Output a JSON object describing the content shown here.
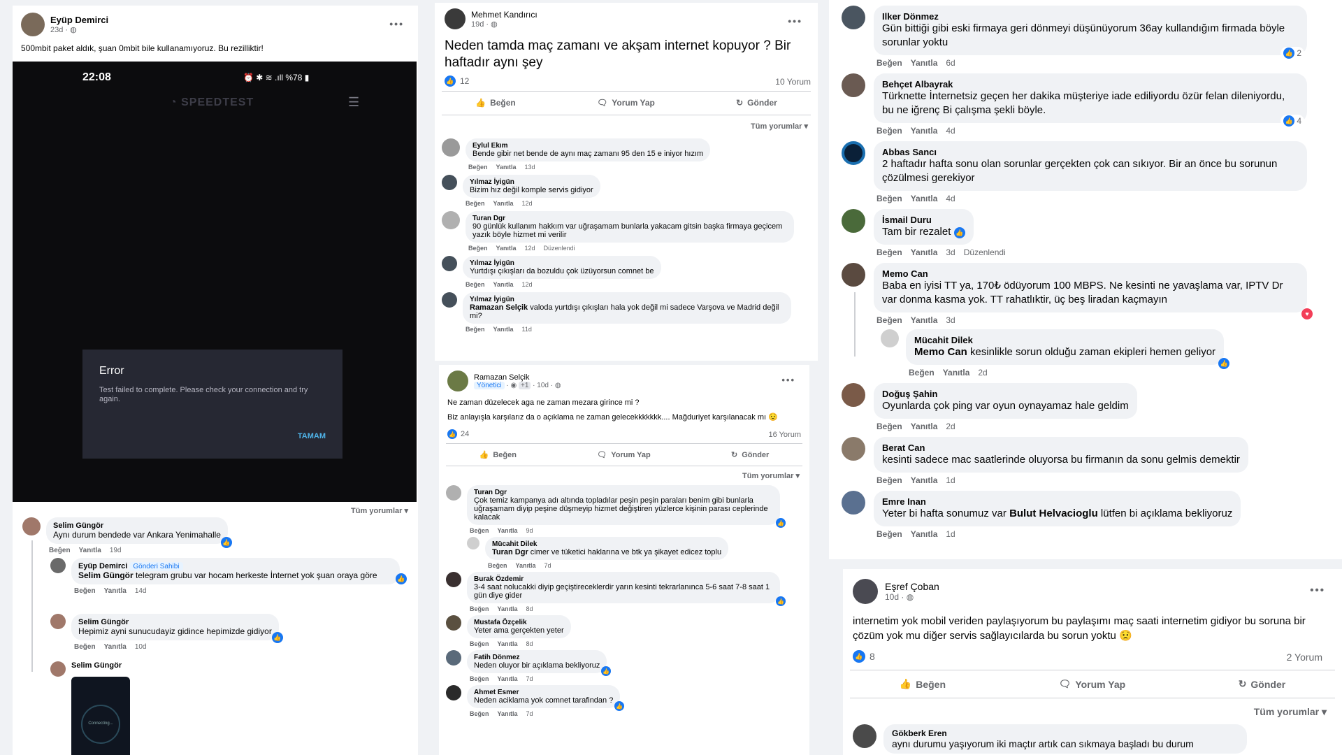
{
  "post1": {
    "author": "Eyüp Demirci",
    "time": "23d · ",
    "text": "500mbit paket aldık, şuan 0mbit bile kullanamıyoruz. Bu rezilliktir!",
    "phone": {
      "clock": "22:08",
      "status": "%78",
      "app_title": "SPEEDTEST",
      "error_title": "Error",
      "error_text": "Test failed to complete. Please check your connection and try again.",
      "error_button": "TAMAM"
    },
    "all_comments": "Tüm yorumlar",
    "comments": [
      {
        "author": "Selim Güngör",
        "text": "Aynı durum bendede var Ankara Yenimahalle",
        "like": "Beğen",
        "reply": "Yanıtla",
        "time": "19d"
      },
      {
        "author": "Eyüp Demirci",
        "badge": "Gönderi Sahibi",
        "mention": "Selim Güngör",
        "text": " telegram grubu var hocam herkeste İnternet yok şuan oraya göre",
        "like": "Beğen",
        "reply": "Yanıtla",
        "time": "14d"
      },
      {
        "author": "Selim Güngör",
        "text": "Hepimiz ayni sunucudayiz gidince hepimizde gidiyor",
        "like": "Beğen",
        "reply": "Yanıtla",
        "time": "10d"
      },
      {
        "author": "Selim Güngör",
        "image_text": "Connecting..."
      }
    ]
  },
  "post2": {
    "author": "Mehmet Kandırıcı",
    "time": "19d · ",
    "text": "Neden tamda maç zamanı ve akşam internet kopuyor ? Bir haftadır aynı şey",
    "reactions": "12",
    "comment_count": "10 Yorum",
    "like": "Beğen",
    "comment": "Yorum Yap",
    "send": "Gönder",
    "all_comments": "Tüm yorumlar",
    "comments": [
      {
        "author": "Eylul Ekım",
        "text": "Bende gibir net bende de aynı maç zamanı 95 den 15 e iniyor hızım",
        "like": "Beğen",
        "reply": "Yanıtla",
        "time": "13d"
      },
      {
        "author": "Yılmaz İyigün",
        "text": "Bizim hız değil komple servis gidiyor",
        "like": "Beğen",
        "reply": "Yanıtla",
        "time": "12d"
      },
      {
        "author": "Turan Dgr",
        "text": "90 günlük kullanım hakkım var uğraşamam bunlarla yakacam gitsin başka firmaya geçicem yazık böyle hizmet mi verilir",
        "like": "Beğen",
        "reply": "Yanıtla",
        "time": "12d",
        "edited": "Düzenlendi"
      },
      {
        "author": "Yılmaz İyigün",
        "text": "Yurtdışı çıkışları da bozuldu çok üzüyorsun comnet be",
        "like": "Beğen",
        "reply": "Yanıtla",
        "time": "12d"
      },
      {
        "author": "Yılmaz İyigün",
        "mention": "Ramazan Selçik",
        "text": " valoda yurtdışı çıkışları hala yok değil mi sadece Varşova ve Madrid değil mi?",
        "like": "Beğen",
        "reply": "Yanıtla",
        "time": "11d"
      }
    ]
  },
  "post3": {
    "author": "Ramazan Selçik",
    "badge": "Yönetici",
    "badge2": "+1",
    "time": "10d · ",
    "text1": "Ne zaman düzelecek aga ne zaman mezara girince mi ?",
    "text2": "Biz anlayışla karşılarız da o açıklama ne zaman gelecekkkkkkk....  Mağduriyet karşılanacak mı",
    "reactions": "24",
    "comment_count": "16 Yorum",
    "like": "Beğen",
    "comment": "Yorum Yap",
    "send": "Gönder",
    "all_comments": "Tüm yorumlar",
    "comments": [
      {
        "author": "Turan Dgr",
        "text": "Çok temiz kampanya adı altında topladılar peşin peşin paraları benim gibi bunlarla uğraşamam diyip peşine düşmeyip hizmet değiştiren yüzlerce kişinin parası ceplerinde kalacak",
        "like": "Beğen",
        "reply": "Yanıtla",
        "time": "9d"
      },
      {
        "author": "Mücahit Dilek",
        "mention": "Turan Dgr",
        "text": " cimer ve tüketici haklarına ve btk ya şikayet edicez toplu",
        "like": "Beğen",
        "reply": "Yanıtla",
        "time": "7d"
      },
      {
        "author": "Burak Özdemir",
        "text": "3-4 saat nolucakki diyip geçiştireceklerdir yarın kesinti tekrarlanınca 5-6 saat 7-8 saat 1 gün diye gider",
        "like": "Beğen",
        "reply": "Yanıtla",
        "time": "8d"
      },
      {
        "author": "Mustafa Özçelik",
        "text": "Yeter ama gerçekten yeter",
        "like": "Beğen",
        "reply": "Yanıtla",
        "time": "8d"
      },
      {
        "author": "Fatih Dönmez",
        "text": "Neden oluyor bir açıklama bekliyoruz",
        "like": "Beğen",
        "reply": "Yanıtla",
        "time": "7d"
      },
      {
        "author": "Ahmet Esmer",
        "text": "Neden aciklama yok comnet tarafindan ?",
        "like": "Beğen",
        "reply": "Yanıtla",
        "time": "7d"
      }
    ]
  },
  "right_comments": [
    {
      "author": "Ilker Dönmez",
      "text": "Gün bittiği gibi eski firmaya geri dönmeyi düşünüyorum 36ay kullandığım firmada böyle sorunlar yoktu",
      "like": "Beğen",
      "reply": "Yanıtla",
      "time": "6d",
      "reactions": "2"
    },
    {
      "author": "Behçet Albayrak",
      "text": "Türknette İnternetsiz geçen her dakika müşteriye iade ediliyordu özür felan dileniyordu, bu ne iğrenç Bi çalışma şekli böyle.",
      "like": "Beğen",
      "reply": "Yanıtla",
      "time": "4d",
      "reactions": "4"
    },
    {
      "author": "Abbas Sancı",
      "text": "2 haftadır hafta sonu olan sorunlar gerçekten çok can sıkıyor. Bir an önce bu sorunun çözülmesi gerekiyor",
      "like": "Beğen",
      "reply": "Yanıtla",
      "time": "4d"
    },
    {
      "author": "İsmail Duru",
      "text": "Tam bir rezalet",
      "like": "Beğen",
      "reply": "Yanıtla",
      "time": "3d",
      "edited": "Düzenlendi"
    },
    {
      "author": "Memo Can",
      "text": "Baba en iyisi TT ya, 170₺ ödüyorum 100 MBPS. Ne kesinti ne yavaşlama var, IPTV Dr var donma kasma yok. TT rahatlıktir, üç beş liradan kaçmayın",
      "like": "Beğen",
      "reply": "Yanıtla",
      "time": "3d"
    },
    {
      "author": "Mücahit Dilek",
      "mention": "Memo Can",
      "text": " kesinlikle sorun olduğu zaman ekipleri hemen geliyor",
      "like": "Beğen",
      "reply": "Yanıtla",
      "time": "2d"
    },
    {
      "author": "Doğuş Şahin",
      "text": "Oyunlarda çok ping var oyun oynayamaz hale geldim",
      "like": "Beğen",
      "reply": "Yanıtla",
      "time": "2d"
    },
    {
      "author": "Berat Can",
      "text": "kesinti sadece mac saatlerinde oluyorsa bu firmanın da sonu gelmis demektir",
      "like": "Beğen",
      "reply": "Yanıtla",
      "time": "1d"
    },
    {
      "author": "Emre Inan",
      "text": "Yeter bi hafta sonumuz var ",
      "mention": "Bulut Helvacioglu",
      "text2": " lütfen bi açıklama bekliyoruz",
      "like": "Beğen",
      "reply": "Yanıtla",
      "time": "1d"
    }
  ],
  "post4": {
    "author": "Eşref Çoban",
    "time": "10d · ",
    "text": "internetim yok mobil veriden paylaşıyorum bu paylaşımı maç saati internetim gidiyor bu soruna bir çözüm yok mu diğer servis sağlayıcılarda bu sorun yoktu",
    "reactions": "8",
    "comment_count": "2 Yorum",
    "like": "Beğen",
    "comment": "Yorum Yap",
    "send": "Gönder",
    "all_comments": "Tüm yorumlar",
    "comments": [
      {
        "author": "Gökberk Eren",
        "text": "aynı durumu yaşıyorum iki maçtır artık can sıkmaya başladı bu durum"
      }
    ]
  },
  "colors": {
    "accent": "#1877f2",
    "muted": "#65676b",
    "bubble": "#f0f2f5"
  }
}
